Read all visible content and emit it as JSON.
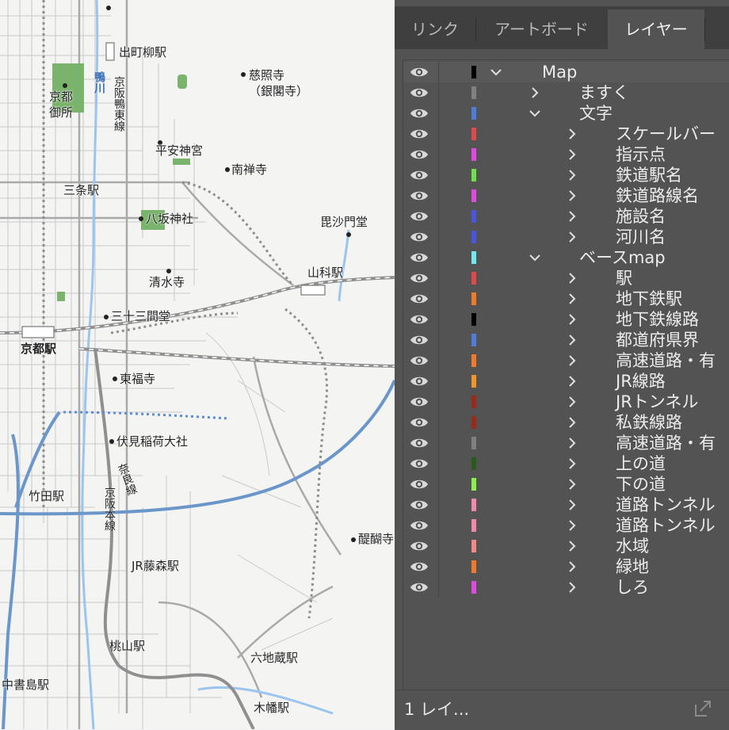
{
  "map": {
    "labels": {
      "demachiyanagi": "出町柳駅",
      "keihan_kamo_line": "京阪鴨東線",
      "kamogawa": "鴨川",
      "kyoto_gosho": "京都\n御所",
      "jishoji": "慈照寺\n（銀閣寺）",
      "heian_jingu": "平安神宮",
      "nanzenji": "南禅寺",
      "sanjo": "三条駅",
      "yasaka": "八坂神社",
      "bishamondo": "毘沙門堂",
      "yamashina": "山科駅",
      "kiyomizu": "清水寺",
      "sanjusangendo": "三十三間堂",
      "kyoto_station": "京都駅",
      "tofukuji": "東福寺",
      "fushimi_inari": "伏見稲荷大社",
      "nara_line": "奈良線",
      "takeda": "竹田駅",
      "keihan_main_line": "京阪本線",
      "daigo": "醍醐寺",
      "jr_fujinomori": "JR藤森駅",
      "momoyama": "桃山駅",
      "rokujizo": "六地蔵駅",
      "nakashojima": "中書島駅",
      "kowata": "木幡駅"
    }
  },
  "panel": {
    "tabs": [
      {
        "label": "リンク",
        "active": false
      },
      {
        "label": "アートボード",
        "active": false
      },
      {
        "label": "レイヤー",
        "active": true
      }
    ],
    "layers": [
      {
        "name": "Map",
        "color": "#000000",
        "depth": 0,
        "expanded": true
      },
      {
        "name": "ますく",
        "color": "#808080",
        "depth": 1,
        "expanded": false
      },
      {
        "name": "文字",
        "color": "#4f7ddc",
        "depth": 1,
        "expanded": true
      },
      {
        "name": "スケールバー",
        "color": "#e04a4a",
        "depth": 2,
        "expanded": false
      },
      {
        "name": "指示点",
        "color": "#e04ae0",
        "depth": 2,
        "expanded": false
      },
      {
        "name": "鉄道駅名",
        "color": "#6fe04a",
        "depth": 2,
        "expanded": false
      },
      {
        "name": "鉄道路線名",
        "color": "#e04ae0",
        "depth": 2,
        "expanded": false
      },
      {
        "name": "施設名",
        "color": "#4a55e0",
        "depth": 2,
        "expanded": false
      },
      {
        "name": "河川名",
        "color": "#4a55e0",
        "depth": 2,
        "expanded": false
      },
      {
        "name": "ベースmap",
        "color": "#6fe8f0",
        "depth": 1,
        "expanded": true
      },
      {
        "name": "駅",
        "color": "#e04a4a",
        "depth": 2,
        "expanded": false
      },
      {
        "name": "地下鉄駅",
        "color": "#f07a2a",
        "depth": 2,
        "expanded": false
      },
      {
        "name": "地下鉄線路",
        "color": "#000000",
        "depth": 2,
        "expanded": false
      },
      {
        "name": "都道府県界",
        "color": "#4f7ddc",
        "depth": 2,
        "expanded": false
      },
      {
        "name": "高速道路・有",
        "color": "#f07a2a",
        "depth": 2,
        "expanded": false
      },
      {
        "name": "JR線路",
        "color": "#f0962a",
        "depth": 2,
        "expanded": false
      },
      {
        "name": "JRトンネル",
        "color": "#9a2a1a",
        "depth": 2,
        "expanded": false
      },
      {
        "name": "私鉄線路",
        "color": "#9a2a1a",
        "depth": 2,
        "expanded": false
      },
      {
        "name": "高速道路・有",
        "color": "#808080",
        "depth": 2,
        "expanded": false
      },
      {
        "name": "上の道",
        "color": "#2a5a1a",
        "depth": 2,
        "expanded": false
      },
      {
        "name": "下の道",
        "color": "#8af04a",
        "depth": 2,
        "expanded": false
      },
      {
        "name": "道路トンネル",
        "color": "#f08aa8",
        "depth": 2,
        "expanded": false
      },
      {
        "name": "道路トンネル",
        "color": "#f08aa8",
        "depth": 2,
        "expanded": false
      },
      {
        "name": "水域",
        "color": "#f08a8a",
        "depth": 2,
        "expanded": false
      },
      {
        "name": "緑地",
        "color": "#f07a2a",
        "depth": 2,
        "expanded": false
      },
      {
        "name": "しろ",
        "color": "#e04ae0",
        "depth": 2,
        "expanded": false
      }
    ],
    "footer": {
      "count": "1 レイ..."
    },
    "icons": {
      "visibility": "eye-icon",
      "expand": "chevron-right-icon",
      "collapse": "chevron-down-icon",
      "export": "export-icon"
    }
  }
}
